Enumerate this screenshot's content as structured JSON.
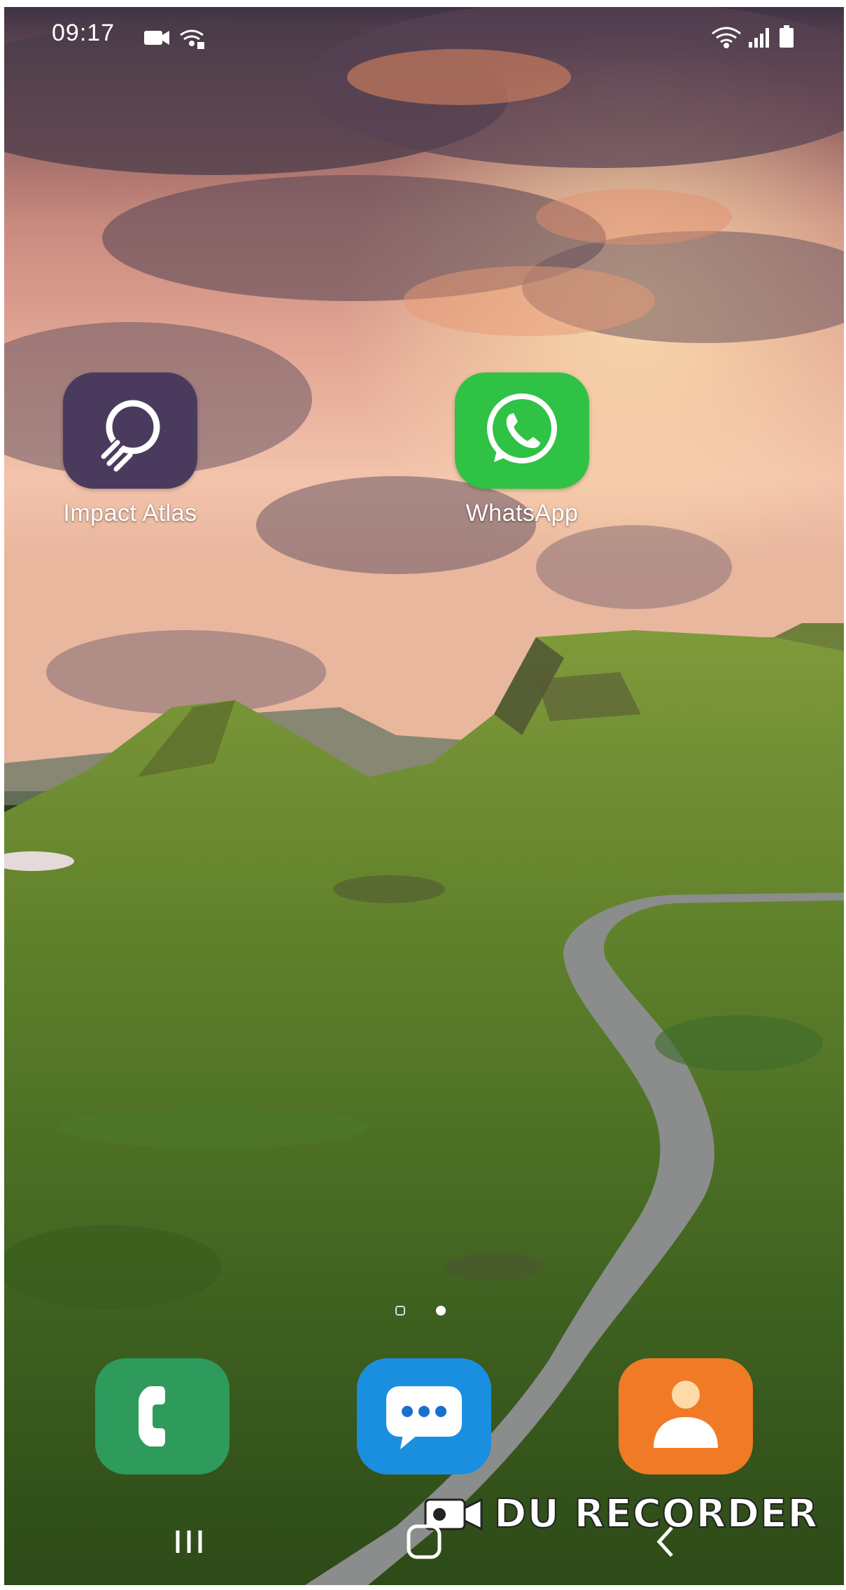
{
  "status_bar": {
    "time": "09:17",
    "left_icons": [
      "video-camera-icon",
      "wifi-upload-icon"
    ],
    "right_icons": [
      "wifi-icon",
      "cellular-signal-icon",
      "battery-icon"
    ]
  },
  "home_apps": [
    {
      "label": "Impact Atlas",
      "icon": "impact-atlas-icon",
      "color": "#4a3b5e"
    },
    {
      "label": "WhatsApp",
      "icon": "whatsapp-icon",
      "color": "#2fc244"
    }
  ],
  "page_indicator": {
    "pages": 2,
    "current": 2
  },
  "dock": [
    {
      "icon": "phone-icon",
      "color": "#2e9a5c"
    },
    {
      "icon": "messages-icon",
      "color": "#1a8fe0"
    },
    {
      "icon": "contacts-icon",
      "color": "#f07a26"
    }
  ],
  "watermark": {
    "text": "DU RECORDER"
  },
  "nav_bar": [
    "recent-apps-button",
    "home-button",
    "back-button"
  ]
}
